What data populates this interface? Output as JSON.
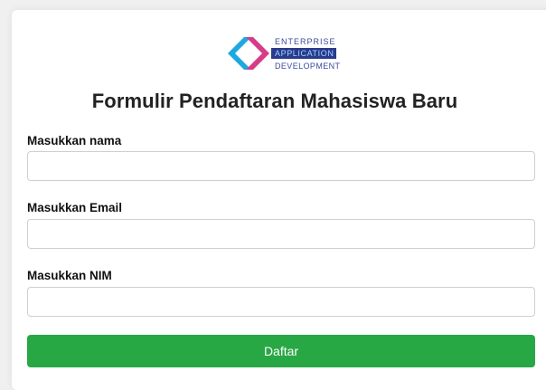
{
  "logo": {
    "line1": "ENTERPRISE",
    "line2": "APPLICATION",
    "line3": "DEVELOPMENT",
    "icon": "diamond-logo-icon",
    "colors": {
      "cyan": "#1ea8e0",
      "magenta": "#d63c8a",
      "dark": "#2a3a8c"
    }
  },
  "form": {
    "title": "Formulir Pendaftaran Mahasiswa Baru",
    "fields": [
      {
        "label": "Masukkan nama",
        "value": "",
        "placeholder": ""
      },
      {
        "label": "Masukkan Email",
        "value": "",
        "placeholder": ""
      },
      {
        "label": "Masukkan NIM",
        "value": "",
        "placeholder": ""
      }
    ],
    "submit_label": "Daftar",
    "accent_color": "#28a745"
  }
}
